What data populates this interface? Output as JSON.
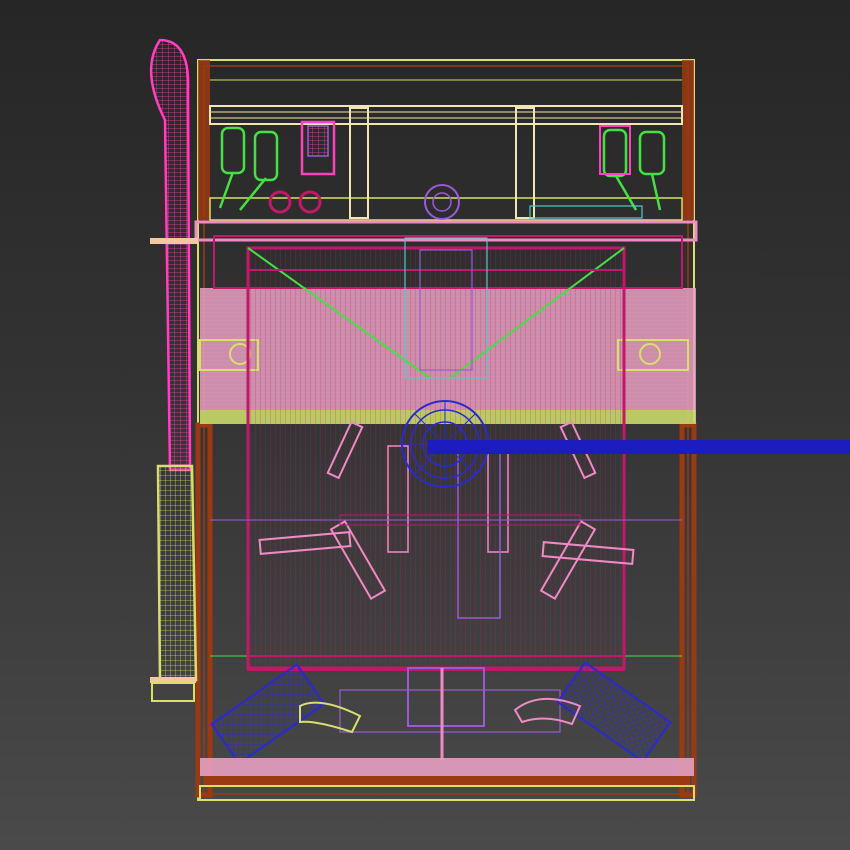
{
  "viewport": {
    "view": "front wireframe",
    "background": {
      "top": "#262626",
      "bottom": "#4a4a4a"
    }
  },
  "model": {
    "colors": {
      "frame_brown": "#9b3a12",
      "frame_yellow": "#d8e06a",
      "light_pink": "#f08ac4",
      "magenta": "#c2186a",
      "hot_pink": "#ff3fbf",
      "green": "#44e044",
      "blue": "#2a2ad0",
      "violet": "#9a5ad8",
      "cyan": "#56c8c8",
      "cream": "#f2e6b0"
    },
    "parts": [
      "outer-frame",
      "top-crossbar",
      "pink-band",
      "drum-body",
      "left-hose",
      "drain-pipe",
      "pulley",
      "shaft",
      "left-foot",
      "right-foot",
      "top-components"
    ]
  }
}
